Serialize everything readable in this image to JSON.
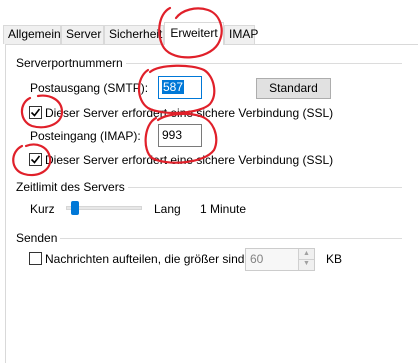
{
  "tabs": [
    {
      "label": "Allgemein"
    },
    {
      "label": "Server"
    },
    {
      "label": "Sicherheit"
    },
    {
      "label": "Erweitert"
    },
    {
      "label": "IMAP"
    }
  ],
  "server_ports": {
    "group_title": "Serverportnummern",
    "smtp_label": "Postausgang (SMTP):",
    "smtp_value": "587",
    "standard_button": "Standard",
    "smtp_ssl_label": "Dieser Server erfordert eine sichere Verbindung (SSL)",
    "smtp_ssl_checked": true,
    "imap_label": "Posteingang (IMAP):",
    "imap_value": "993",
    "imap_ssl_label": "Dieser Server erfordert eine sichere Verbindung (SSL)",
    "imap_ssl_checked": true
  },
  "timeout": {
    "group_title": "Zeitlimit des Servers",
    "short_label": "Kurz",
    "long_label": "Lang",
    "value_label": "1 Minute",
    "slider_fraction": 0.1
  },
  "send": {
    "group_title": "Senden",
    "split_label": "Nachrichten aufteilen, die größer sind als",
    "split_checked": false,
    "split_value": "60",
    "unit": "KB"
  },
  "colors": {
    "annotation": "#e0202a",
    "accent": "#0078d7"
  }
}
